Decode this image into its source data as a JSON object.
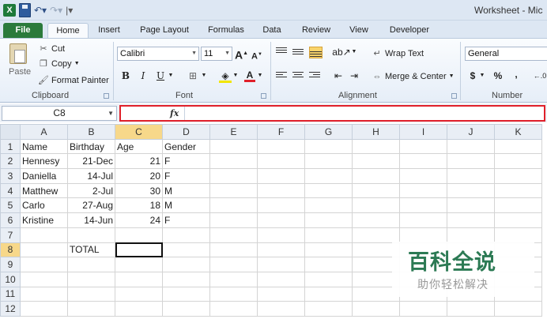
{
  "window": {
    "title": "Worksheet - Mic",
    "app_icon": "excel-icon"
  },
  "tabs": [
    "File",
    "Home",
    "Insert",
    "Page Layout",
    "Formulas",
    "Data",
    "Review",
    "View",
    "Developer"
  ],
  "clipboard": {
    "paste": "Paste",
    "cut": "Cut",
    "copy": "Copy",
    "format_painter": "Format Painter",
    "label": "Clipboard"
  },
  "font": {
    "name": "Calibri",
    "size": "11",
    "grow": "A",
    "shrink": "A",
    "bold": "B",
    "italic": "I",
    "underline": "U",
    "color_a": "A",
    "label": "Font"
  },
  "alignment": {
    "wrap_text": "Wrap Text",
    "merge_center": "Merge & Center",
    "label": "Alignment"
  },
  "number": {
    "format": "General",
    "currency": "$",
    "percent": "%",
    "comma": ",",
    "label": "Number"
  },
  "formula_bar": {
    "name_box": "C8",
    "fx": "fx",
    "formula": ""
  },
  "sheet": {
    "columns": [
      "A",
      "B",
      "C",
      "D",
      "E",
      "F",
      "G",
      "H",
      "I",
      "J",
      "K"
    ],
    "selected_column": "C",
    "selected_row": 8,
    "rows": [
      {
        "n": 1,
        "cells": [
          "Name",
          "Birthday",
          "Age",
          "Gender"
        ]
      },
      {
        "n": 2,
        "cells": [
          "Hennesy",
          "21-Dec",
          "21",
          "F"
        ]
      },
      {
        "n": 3,
        "cells": [
          "Daniella",
          "14-Jul",
          "20",
          "F"
        ]
      },
      {
        "n": 4,
        "cells": [
          "Matthew",
          "2-Jul",
          "30",
          "M"
        ]
      },
      {
        "n": 5,
        "cells": [
          "Carlo",
          "27-Aug",
          "18",
          "M"
        ]
      },
      {
        "n": 6,
        "cells": [
          "Kristine",
          "14-Jun",
          "24",
          "F"
        ]
      },
      {
        "n": 7,
        "cells": [
          "",
          "",
          "",
          ""
        ]
      },
      {
        "n": 8,
        "cells": [
          "",
          "TOTAL",
          "",
          ""
        ]
      },
      {
        "n": 9,
        "cells": [
          "",
          "",
          "",
          ""
        ]
      },
      {
        "n": 10,
        "cells": [
          "",
          "",
          "",
          ""
        ]
      },
      {
        "n": 11,
        "cells": [
          "",
          "",
          "",
          ""
        ]
      },
      {
        "n": 12,
        "cells": [
          "",
          "",
          "",
          ""
        ]
      }
    ]
  },
  "watermark": {
    "title": "百科全说",
    "subtitle": "助你轻松解决"
  }
}
